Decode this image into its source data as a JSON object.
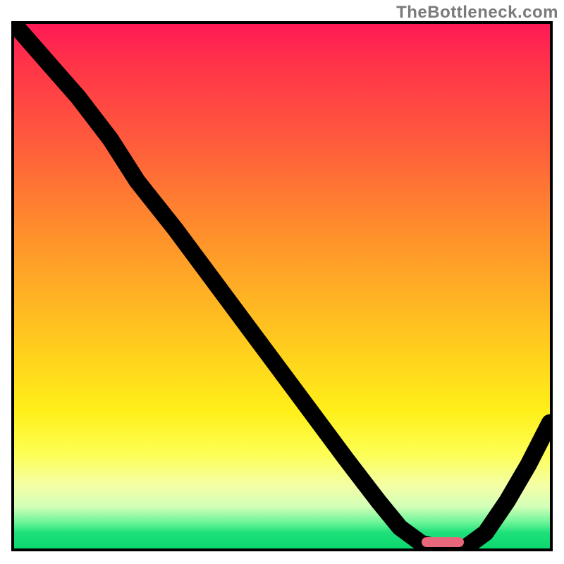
{
  "watermark": "TheBottleneck.com",
  "colors": {
    "border": "#000000",
    "curve": "#000000",
    "marker": "#e8677a",
    "gradient_stops": [
      "#ff1a56",
      "#ff3448",
      "#ff5a3d",
      "#ff8a2d",
      "#ffb224",
      "#ffd41c",
      "#fff01a",
      "#fdff55",
      "#f4ffa6",
      "#d3ffb8",
      "#6cf598",
      "#1ee07a",
      "#0cd86e"
    ]
  },
  "chart_data": {
    "type": "line",
    "title": "",
    "xlabel": "",
    "ylabel": "",
    "xlim": [
      0,
      100
    ],
    "ylim": [
      0,
      100
    ],
    "series": [
      {
        "name": "curve",
        "x": [
          0,
          6,
          12,
          18,
          23,
          30,
          38,
          46,
          54,
          62,
          68,
          72,
          76,
          80,
          84,
          88,
          92,
          96,
          100
        ],
        "y": [
          100,
          93,
          86,
          78,
          70,
          61,
          50,
          39,
          28,
          17,
          9,
          4,
          1,
          0,
          0,
          3,
          9,
          16,
          24
        ]
      }
    ],
    "marker": {
      "name": "optimal-range",
      "x_start": 76,
      "x_end": 84,
      "y": 0
    }
  }
}
